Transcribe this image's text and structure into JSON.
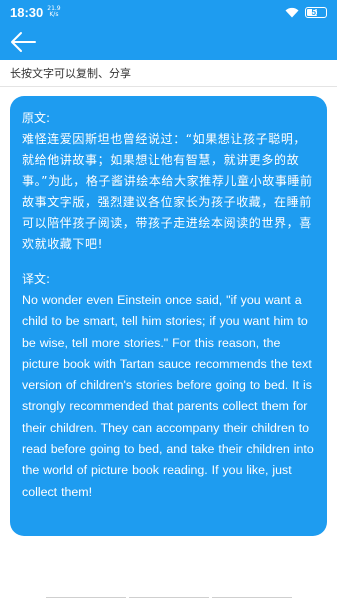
{
  "status": {
    "time": "18:30",
    "net_speed_value": "21.9",
    "net_speed_unit": "K/s",
    "battery": "51"
  },
  "header": {
    "back_icon": "arrow-left-icon"
  },
  "hint": "长按文字可以复制、分享",
  "content": {
    "original_label": "原文:",
    "original_text": "难怪连爱因斯坦也曾经说过：“如果想让孩子聪明，就给他讲故事；如果想让他有智慧，就讲更多的故事。”为此，格子酱讲绘本给大家推荐儿童小故事睡前故事文字版，强烈建议各位家长为孩子收藏，在睡前可以陪伴孩子阅读，带孩子走进绘本阅读的世界，喜欢就收藏下吧!",
    "translation_label": "译文:",
    "translation_text": "No wonder even Einstein once said, \"if you want a child to be smart, tell him stories; if you want him to be wise, tell more stories.\" For this reason, the picture book with Tartan sauce recommends the text version of children's stories before going to bed. It is strongly recommended that parents collect them for their children. They can accompany their children to read before going to bed, and take their children into the world of picture book reading. If you like, just collect them!"
  },
  "colors": {
    "accent": "#1e9cf0",
    "text_on_accent": "#ffffff"
  }
}
